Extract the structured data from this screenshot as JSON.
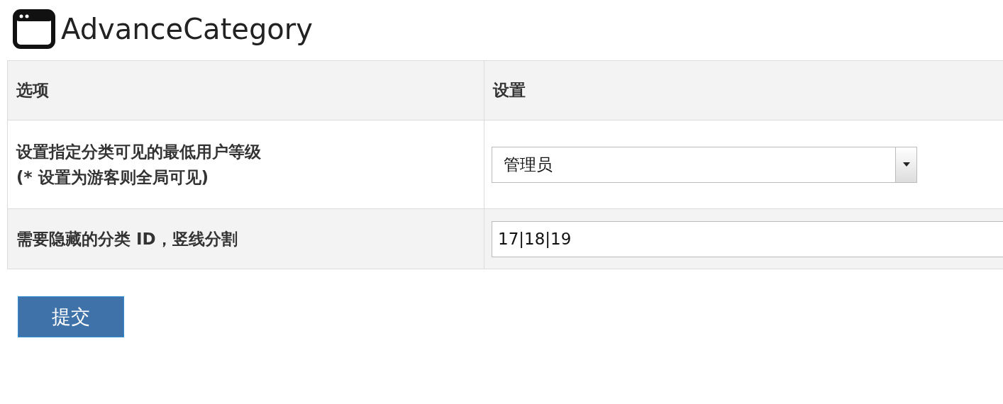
{
  "window": {
    "title": "AdvanceCategory"
  },
  "table": {
    "columns": [
      "选项",
      "设置"
    ],
    "rows": [
      {
        "kind": "select",
        "label_lines": [
          "设置指定分类可见的最低用户等级",
          "(* 设置为游客则全局可见)"
        ],
        "value": "管理员"
      },
      {
        "kind": "text",
        "label_lines": [
          "需要隐藏的分类 ID，竖线分割"
        ],
        "value": "17|18|19"
      }
    ]
  },
  "buttons": [
    "提交"
  ]
}
